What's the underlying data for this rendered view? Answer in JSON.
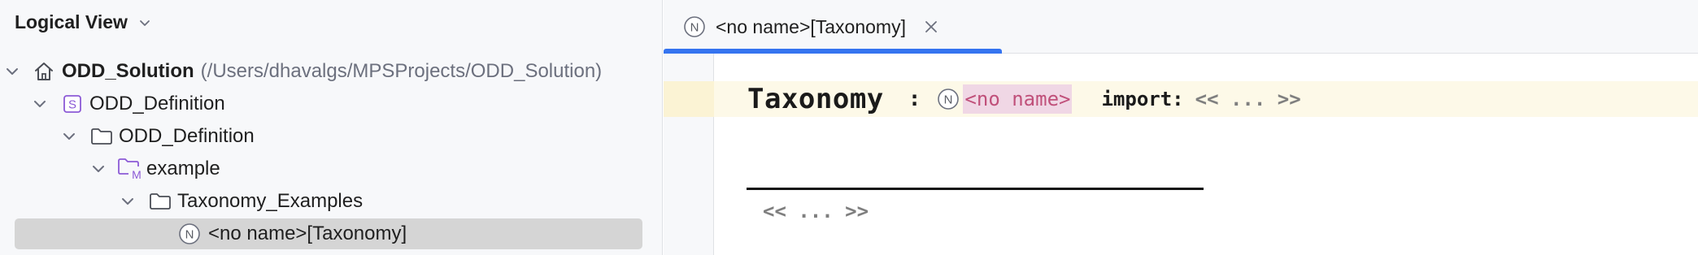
{
  "project_pane": {
    "title": "Logical View",
    "tree": [
      {
        "label": "ODD_Solution",
        "path": "(/Users/dhavalgs/MPSProjects/ODD_Solution)",
        "icon": "home-icon"
      },
      {
        "label": "ODD_Definition",
        "icon": "solution-s-icon"
      },
      {
        "label": "ODD_Definition",
        "icon": "folder-icon"
      },
      {
        "label": "example",
        "icon": "model-folder-icon"
      },
      {
        "label": "Taxonomy_Examples",
        "icon": "folder-icon"
      },
      {
        "label": "<no name>[Taxonomy]",
        "icon": "node-n-icon",
        "selected": true
      }
    ]
  },
  "editor": {
    "tab": {
      "label": "<no name>[Taxonomy]",
      "icon_letter": "N",
      "active": true
    },
    "content": {
      "concept": "Taxonomy",
      "colon": ":",
      "name_placeholder": "<no name>",
      "import_label": "import:",
      "import_placeholder": "<< ... >>",
      "body_placeholder": "<< ... >>"
    }
  },
  "icons": {
    "solution_letter": "S",
    "node_letter": "N",
    "model_letter": "M"
  },
  "colors": {
    "accent": "#3574f0",
    "selection": "#d5d5d5",
    "name_cell_bg": "#f0d7e5",
    "name_cell_text": "#c0507a",
    "current_line": "#fdf9e8",
    "solution_icon": "#8c5ad6"
  }
}
